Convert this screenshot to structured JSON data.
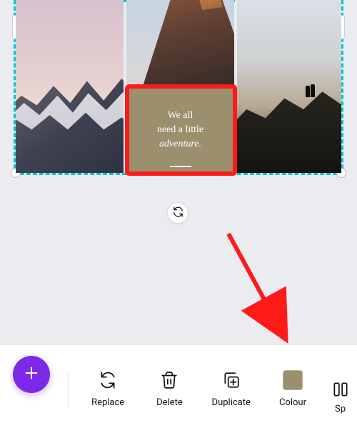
{
  "quote": {
    "line1": "We all",
    "line2": "need a little",
    "line3": "adventure."
  },
  "actions": {
    "replace": "Replace",
    "delete": "Delete",
    "duplicate": "Duplicate",
    "colour": "Colour",
    "spacing": "Spacing"
  },
  "colour_swatch": "#9b8f6e",
  "annotation": {
    "arrow_color": "#ff1a1a"
  }
}
